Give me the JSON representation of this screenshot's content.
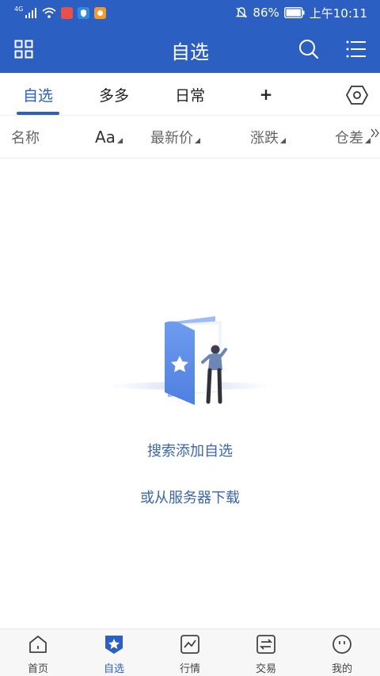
{
  "colors": {
    "brand_blue": "#2c5fc2",
    "link_blue": "#3a66b0"
  },
  "status_bar": {
    "network": "4G",
    "battery": "86%",
    "time": "上午10:11",
    "icons": [
      "signal-icon",
      "wifi-icon",
      "app-notification-icons",
      "mute-icon",
      "battery-icon"
    ]
  },
  "header": {
    "title": "自选",
    "left_icon": "grid-icon",
    "right_icons": [
      "search-icon",
      "menu-icon"
    ]
  },
  "tabs": [
    {
      "label": "自选",
      "active": true
    },
    {
      "label": "多多",
      "active": false
    },
    {
      "label": "日常",
      "active": false
    },
    {
      "label": "+",
      "active": false
    }
  ],
  "tab_settings_icon": "hexagon-settings-icon",
  "columns": [
    {
      "label": "名称",
      "sortable": false
    },
    {
      "label": "Aa",
      "sortable": true
    },
    {
      "label": "最新价",
      "sortable": true
    },
    {
      "label": "涨跌",
      "sortable": true
    },
    {
      "label": "仓差",
      "sortable": true
    }
  ],
  "columns_more_icon": "double-chevron-right-icon",
  "empty_state": {
    "illustration": "open-folder-with-person-illustration",
    "search_link": "搜索添加自选",
    "download_link": "或从服务器下载"
  },
  "bottom_nav": [
    {
      "label": "首页",
      "icon": "home-icon",
      "active": false
    },
    {
      "label": "自选",
      "icon": "star-badge-icon",
      "active": true
    },
    {
      "label": "行情",
      "icon": "chart-icon",
      "active": false
    },
    {
      "label": "交易",
      "icon": "exchange-icon",
      "active": false
    },
    {
      "label": "我的",
      "icon": "face-icon",
      "active": false
    }
  ]
}
